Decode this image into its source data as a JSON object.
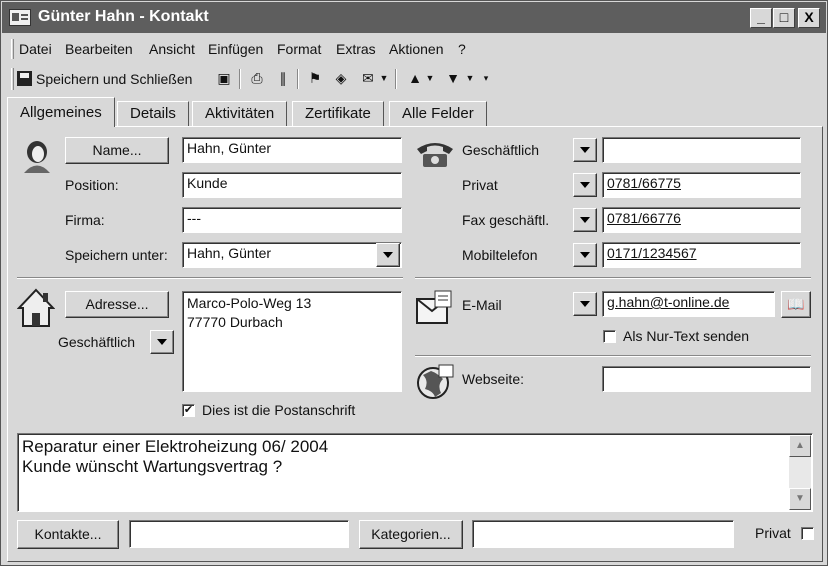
{
  "window": {
    "title": "Günter Hahn - Kontakt",
    "buttons": {
      "minimize": "_",
      "maximize": "□",
      "close": "X"
    }
  },
  "menu": [
    "Datei",
    "Bearbeiten",
    "Ansicht",
    "Einfügen",
    "Format",
    "Extras",
    "Aktionen",
    "?"
  ],
  "toolbar": {
    "save_close_label": "Speichern und Schließen"
  },
  "tabs": [
    "Allgemeines",
    "Details",
    "Aktivitäten",
    "Zertifikate",
    "Alle Felder"
  ],
  "contact": {
    "name_button": "Name...",
    "name_value": "Hahn, Günter",
    "position_label": "Position:",
    "position_value": "Kunde",
    "company_label": "Firma:",
    "company_value": "---",
    "file_as_label": "Speichern unter:",
    "file_as_value": "Hahn, Günter"
  },
  "phones": [
    {
      "label": "Geschäftlich",
      "value": ""
    },
    {
      "label": "Privat",
      "value": "0781/66775"
    },
    {
      "label": "Fax geschäftl.",
      "value": "0781/66776"
    },
    {
      "label": "Mobiltelefon",
      "value": "0171/1234567"
    }
  ],
  "address": {
    "button": "Adresse...",
    "type": "Geschäftlich",
    "line1": "Marco-Polo-Weg 13",
    "line2": "77770 Durbach",
    "postal_label": "Dies ist die Postanschrift",
    "postal_checked": "✔"
  },
  "email": {
    "label": "E-Mail",
    "value": "g.hahn@t-online.de",
    "plain_text_label": "Als Nur-Text senden"
  },
  "web": {
    "label": "Webseite:",
    "value": ""
  },
  "notes": {
    "line1": "Reparatur einer Elektroheizung 06/ 2004",
    "line2": "Kunde wünscht Wartungsvertrag ?"
  },
  "footer": {
    "contacts_button": "Kontakte...",
    "contacts_value": "",
    "categories_button": "Kategorien...",
    "categories_value": "",
    "private_label": "Privat"
  }
}
